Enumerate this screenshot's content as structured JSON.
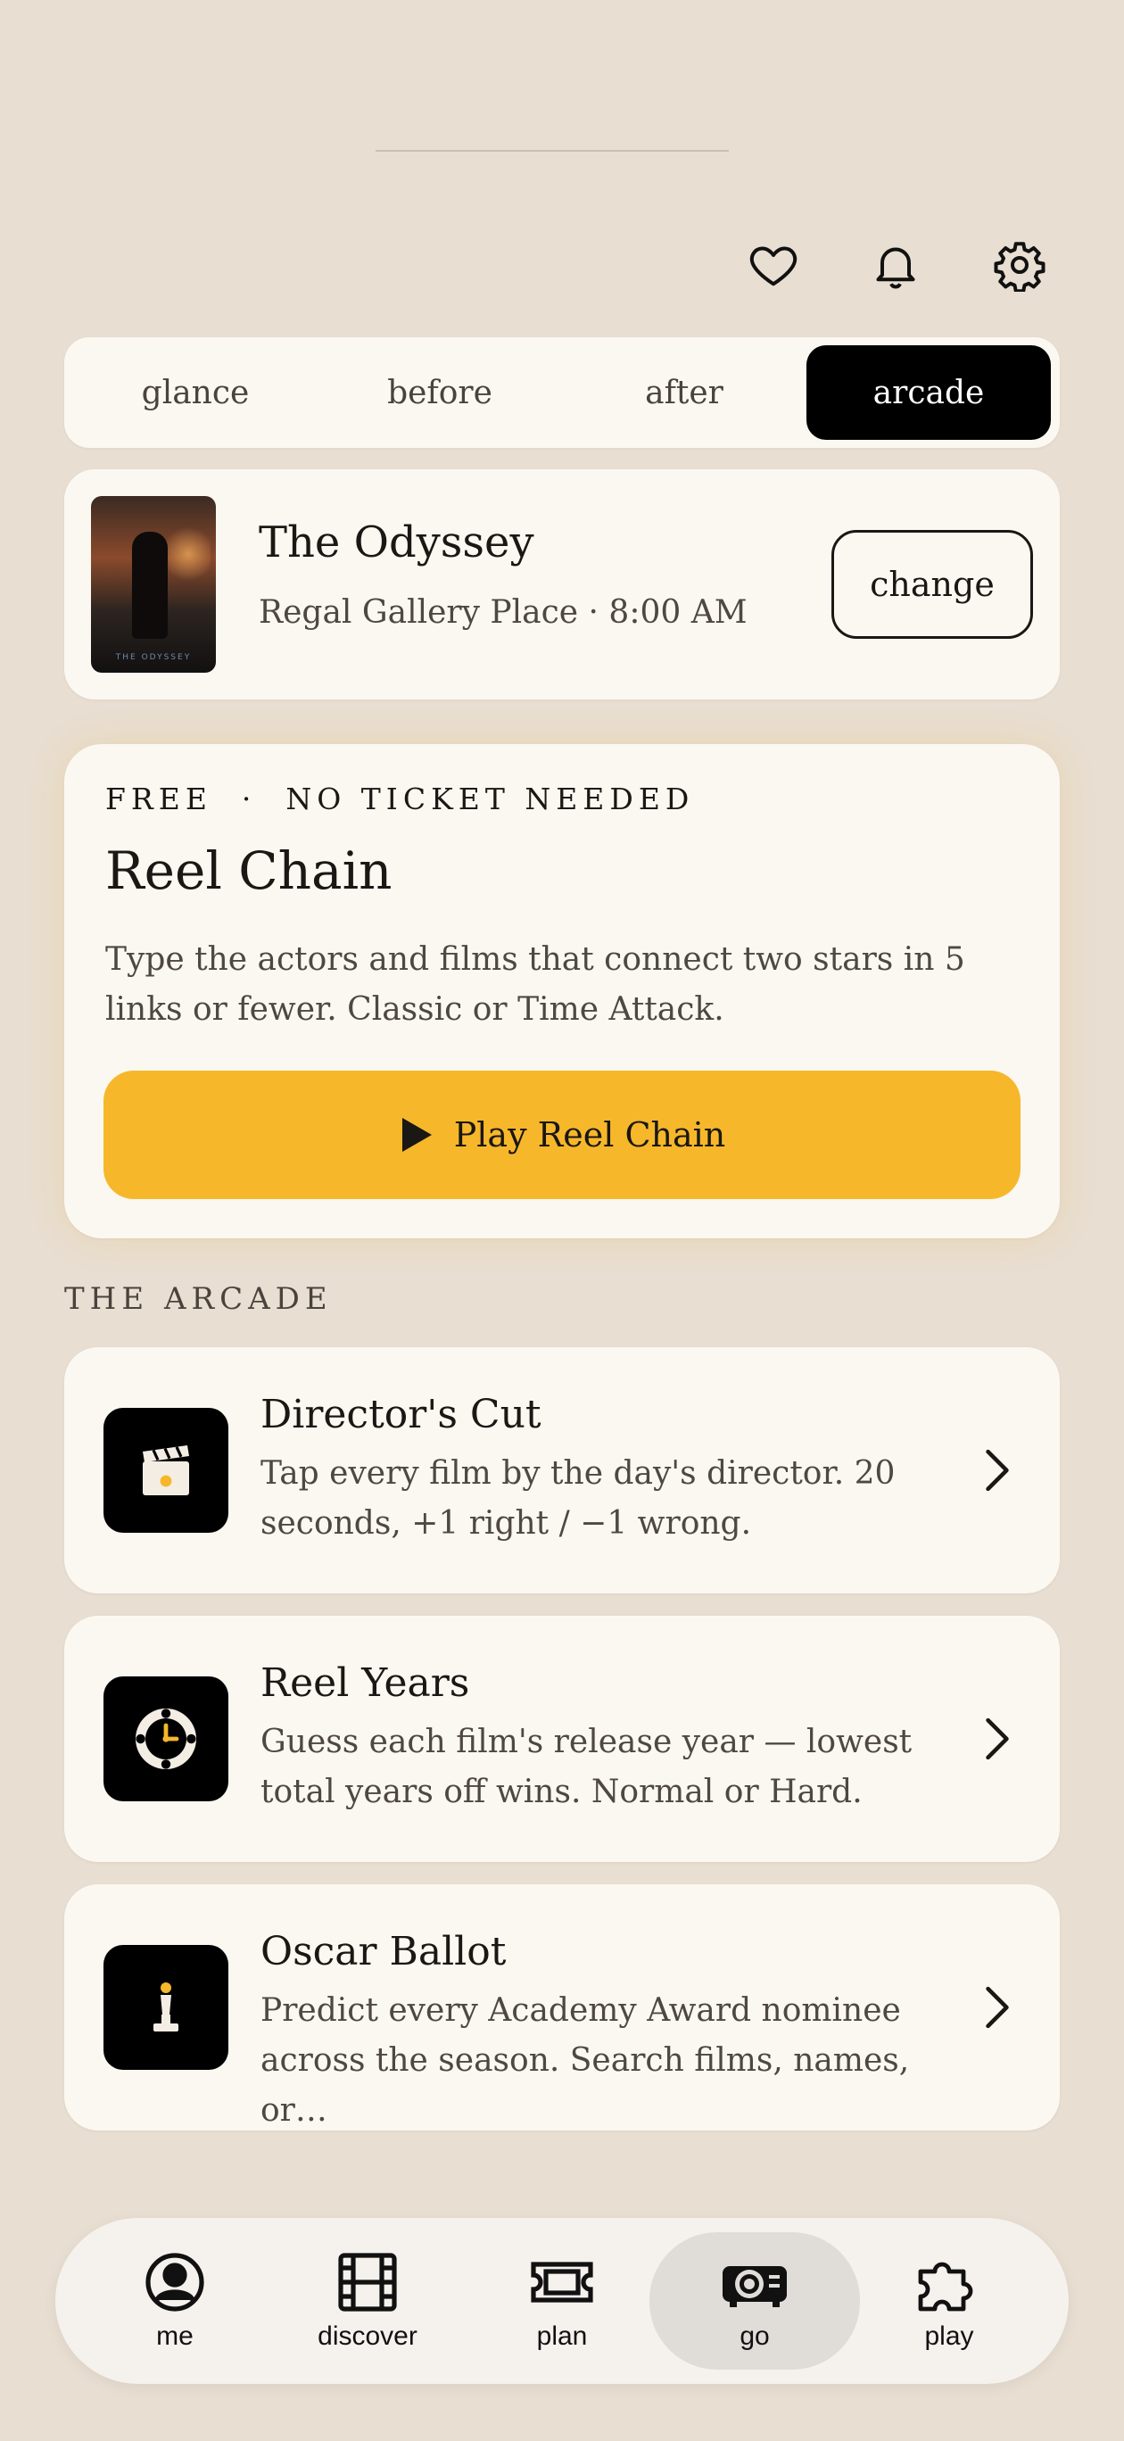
{
  "header": {
    "icons": [
      "heart-icon",
      "bell-icon",
      "gear-icon"
    ]
  },
  "tabs": [
    {
      "label": "glance",
      "active": false
    },
    {
      "label": "before",
      "active": false
    },
    {
      "label": "after",
      "active": false
    },
    {
      "label": "arcade",
      "active": true
    }
  ],
  "movie": {
    "title": "The Odyssey",
    "subtitle": "Regal Gallery Place · 8:00 AM",
    "poster_text": "THE ODYSSEY",
    "change_label": "change"
  },
  "feature": {
    "eyebrow": "FREE  ·  NO TICKET NEEDED",
    "title": "Reel Chain",
    "description": "Type the actors and films that connect two stars in 5 links or fewer. Classic or Time Attack.",
    "play_label": "Play Reel Chain",
    "accent_color": "#f6b72a"
  },
  "arcade": {
    "section_label": "THE ARCADE",
    "games": [
      {
        "title": "Director's Cut",
        "description": "Tap every film by the day's director. 20 seconds, +1 right / −1 wrong.",
        "icon": "clapperboard-icon"
      },
      {
        "title": "Reel Years",
        "description": "Guess each film's release year — lowest total years off wins. Normal or Hard.",
        "icon": "film-reel-clock-icon"
      },
      {
        "title": "Oscar Ballot",
        "description": "Predict every Academy Award nominee across the season. Search films, names, or…",
        "icon": "oscar-statuette-icon"
      }
    ]
  },
  "nav": {
    "items": [
      {
        "label": "me",
        "icon": "person-icon",
        "active": false
      },
      {
        "label": "discover",
        "icon": "film-strip-icon",
        "active": false
      },
      {
        "label": "plan",
        "icon": "ticket-icon",
        "active": false
      },
      {
        "label": "go",
        "icon": "projector-icon",
        "active": true
      },
      {
        "label": "play",
        "icon": "puzzle-icon",
        "active": false
      }
    ]
  }
}
